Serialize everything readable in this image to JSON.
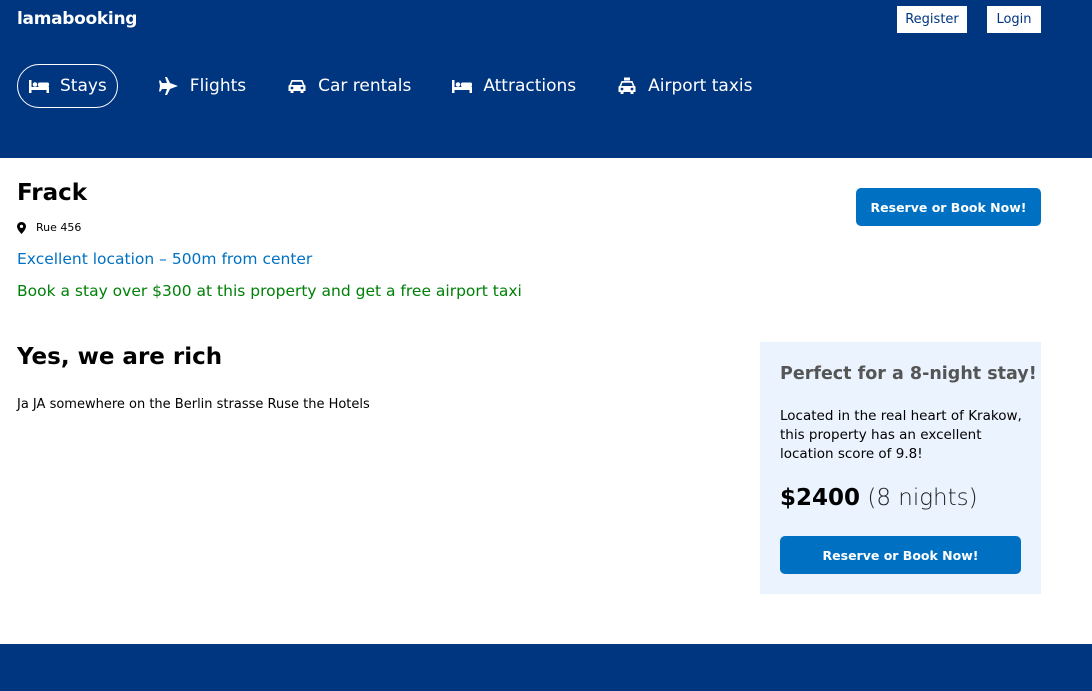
{
  "navbar": {
    "logo": "lamabooking",
    "register_label": "Register",
    "login_label": "Login"
  },
  "header": {
    "items": [
      {
        "label": "Stays",
        "icon": "bed-icon",
        "active": true
      },
      {
        "label": "Flights",
        "icon": "plane-icon",
        "active": false
      },
      {
        "label": "Car rentals",
        "icon": "car-icon",
        "active": false
      },
      {
        "label": "Attractions",
        "icon": "bed-icon",
        "active": false
      },
      {
        "label": "Airport taxis",
        "icon": "taxi-icon",
        "active": false
      }
    ]
  },
  "hotel": {
    "title": "Frack",
    "address": "Rue 456",
    "distance": "Excellent location – 500m from center",
    "price_highlight": "Book a stay over $300 at this property and get a free airport taxi",
    "book_button": "Reserve or Book Now!"
  },
  "details": {
    "title": "Yes, we are rich",
    "description": "Ja JA somewhere on the Berlin strasse Ruse the Hotels"
  },
  "price_box": {
    "title": "Perfect for a 8-night stay!",
    "description": "Located in the real heart of Krakow, this property has an excellent location score of 9.8!",
    "amount": "$2400",
    "nights": "(8 nights)",
    "book_button": "Reserve or Book Now!"
  },
  "colors": {
    "brand": "#003580",
    "button": "#0071c2",
    "highlight_green": "#008009",
    "price_box_bg": "#ebf3ff"
  }
}
